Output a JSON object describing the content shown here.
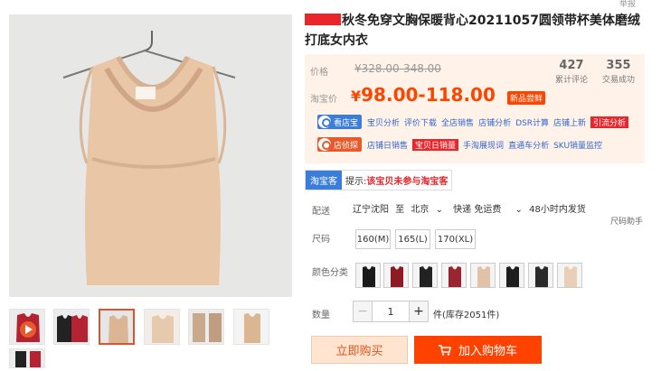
{
  "product": {
    "title": "秋冬免穿文胸保暖背心20211057圆领带杯美体磨绒打底女内衣",
    "report_link": "举报"
  },
  "price": {
    "label": "价格",
    "original": "¥328.00-348.00",
    "taobao_label": "淘宝价",
    "current_symbol": "¥",
    "current": "98.00-118.00",
    "new_badge": "新品尝鲜"
  },
  "stats": {
    "reviews_count": "427",
    "reviews_label": "累计评论",
    "deals_count": "355",
    "deals_label": "交易成功"
  },
  "tools": {
    "row1_badge": "看店宝",
    "row1_links": [
      "宝贝分析",
      "评价下载",
      "全店销售",
      "店铺分析",
      "DSR计算",
      "店铺上新",
      "引流分析"
    ],
    "row2_badge": "店侦探",
    "row2_links": [
      "店铺日销售",
      "宝贝日销量",
      "手淘展现词",
      "直通车分析",
      "SKU销量监控"
    ]
  },
  "taobaoke": {
    "tag": "淘宝客",
    "tip_prefix": "提示:",
    "tip_text": "该宝贝未参与淘宝客"
  },
  "delivery": {
    "label": "配送",
    "from": "辽宁沈阳",
    "to_word": "至",
    "to": "北京",
    "speed": "快递 免运费",
    "promise": "48小时内发货",
    "size_helper": "尺码助手"
  },
  "size": {
    "label": "尺码",
    "options": [
      "160(M)",
      "165(L)",
      "170(XL)"
    ]
  },
  "color": {
    "label": "颜色分类",
    "swatches": [
      "#1a1a1a",
      "#8e1b24",
      "#222222",
      "#9a2530",
      "#e2c2a6",
      "#1e1e1e",
      "#2a2a2a",
      "#e9cfb6"
    ]
  },
  "quantity": {
    "label": "数量",
    "minus": "−",
    "value": "1",
    "plus": "+",
    "stock": "件(库存2051件)"
  },
  "actions": {
    "buy_now": "立即购买",
    "add_cart": "加入购物车"
  },
  "gallery": {
    "thumb_colors": [
      "#c33a2b",
      "#b52231",
      "#d9b595",
      "#e6c8ae",
      "#c8a98b",
      "#dcb593",
      "#b52231"
    ]
  }
}
